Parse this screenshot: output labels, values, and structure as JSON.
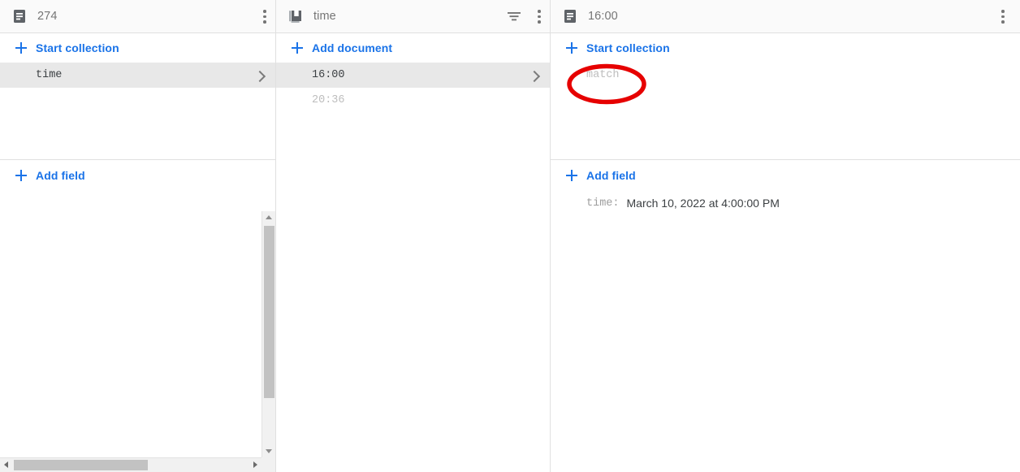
{
  "theme": {
    "accent": "#1a73e8",
    "header_bg": "#fafafa",
    "selected_row_bg": "#e8e8e8",
    "border": "#e0e0e0",
    "muted_text": "#bdbdbd",
    "annotation_color": "#e60000"
  },
  "columns": {
    "document_panel": {
      "header": {
        "icon": "document-icon",
        "title": "274",
        "menu_icon": "more-vert-icon"
      },
      "add_collection_label": "Start collection",
      "collections": [
        {
          "name": "time",
          "selected": true,
          "chevron": "chevron-right-icon"
        }
      ],
      "add_field_label": "Add field",
      "fields": []
    },
    "collection_panel": {
      "header": {
        "icon": "collection-icon",
        "title": "time",
        "filter_icon": "filter-icon",
        "menu_icon": "more-vert-icon"
      },
      "add_document_label": "Add document",
      "documents": [
        {
          "name": "16:00",
          "selected": true,
          "muted": false,
          "chevron": "chevron-right-icon"
        },
        {
          "name": "20:36",
          "selected": false,
          "muted": true,
          "chevron": ""
        }
      ]
    },
    "subdocument_panel": {
      "header": {
        "icon": "document-icon",
        "title": "16:00",
        "menu_icon": "more-vert-icon"
      },
      "add_collection_label": "Start collection",
      "collections": [
        {
          "name": "match",
          "selected": false,
          "muted": true,
          "annotated": true
        }
      ],
      "add_field_label": "Add field",
      "fields": [
        {
          "key": "time:",
          "value": "March 10, 2022 at 4:00:00 PM"
        }
      ]
    }
  },
  "annotation": {
    "shape": "ellipse",
    "color": "#e60000",
    "target_text": "match"
  }
}
